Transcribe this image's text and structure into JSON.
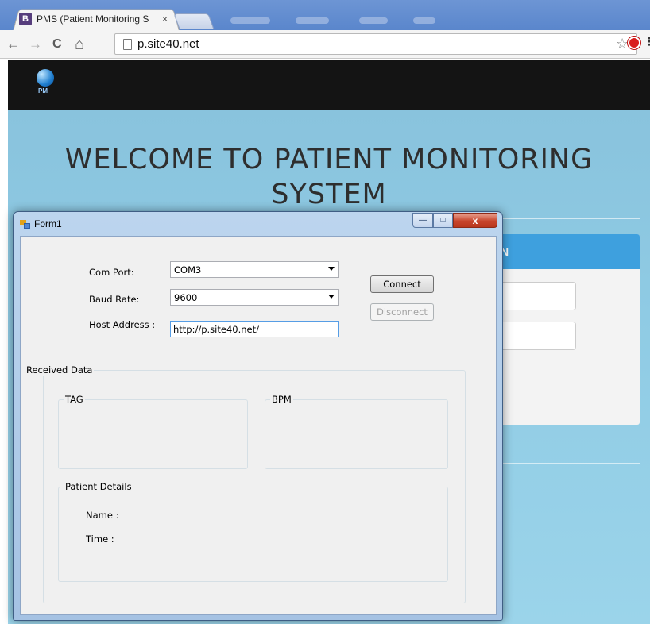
{
  "browser": {
    "tab_favicon": "B",
    "tab_title": "PMS (Patient Monitoring S",
    "tab_close": "×",
    "url": "p.site40.net",
    "icons": {
      "back": "back-arrow-icon",
      "forward": "forward-arrow-icon",
      "reload": "reload-icon",
      "home": "home-icon",
      "page": "page-icon",
      "bookmark": "star-icon",
      "extension": "stop-icon",
      "menu": "menu-icon"
    },
    "glyphs": {
      "back": "←",
      "forward": "→",
      "reload": "C",
      "home": "⌂",
      "star": "☆",
      "menu": "⋮"
    }
  },
  "site": {
    "logo_text": "PM",
    "heading_line1": "WELCOME TO PATIENT MONITORING",
    "heading_line2": "SYSTEM",
    "login_header_visible": "N",
    "accent": "#3ea0de",
    "navbar_bg": "#141414",
    "hero_bg": "#8fcbe4"
  },
  "form": {
    "title": "Form1",
    "caption": {
      "minimize": "—",
      "maximize": "□",
      "close": "x"
    },
    "com_port_label": "Com Port:",
    "com_port_value": "COM3",
    "baud_rate_label": "Baud Rate:",
    "baud_rate_value": "9600",
    "host_label": "Host Address :",
    "host_value": "http://p.site40.net/",
    "connect_label": "Connect",
    "disconnect_label": "Disconnect",
    "received_data_label": "Received Data",
    "tag_label": "TAG",
    "bpm_label": "BPM",
    "patient_details_label": "Patient Details",
    "name_label": "Name :",
    "time_label": "Time :"
  }
}
